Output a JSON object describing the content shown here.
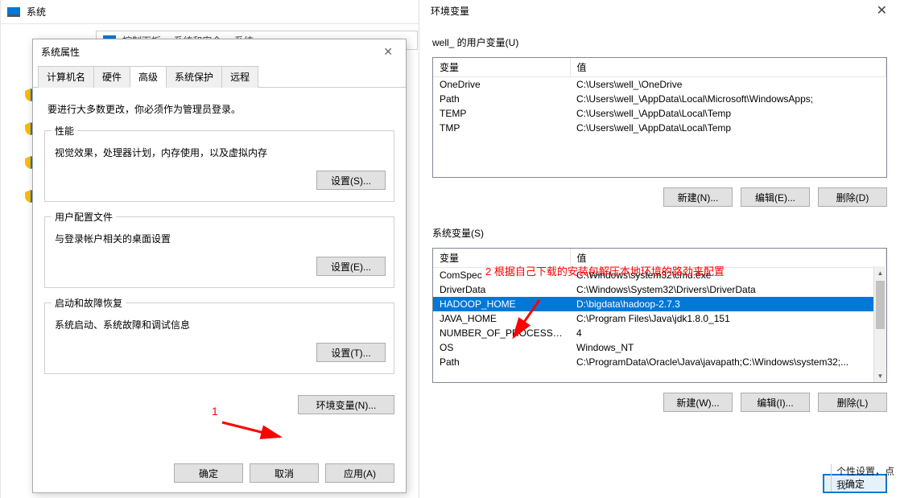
{
  "bg": {
    "title": "系统",
    "breadcrumb": {
      "item1": "控制面板",
      "item2": "系统和安全",
      "item3": "系统"
    }
  },
  "sysprops": {
    "title": "系统属性",
    "tabs": {
      "computer": "计算机名",
      "hardware": "硬件",
      "advanced": "高级",
      "protection": "系统保护",
      "remote": "远程"
    },
    "admin_note": "要进行大多数更改，你必须作为管理员登录。",
    "perf": {
      "title": "性能",
      "desc": "视觉效果，处理器计划，内存使用，以及虚拟内存",
      "btn": "设置(S)..."
    },
    "userprof": {
      "title": "用户配置文件",
      "desc": "与登录帐户相关的桌面设置",
      "btn": "设置(E)..."
    },
    "startup": {
      "title": "启动和故障恢复",
      "desc": "系统启动、系统故障和调试信息",
      "btn": "设置(T)..."
    },
    "env_btn": "环境变量(N)...",
    "buttons": {
      "ok": "确定",
      "cancel": "取消",
      "apply": "应用(A)"
    }
  },
  "annotations": {
    "a1": "1",
    "a2": "2 根据自己下载的安装包解压本地环境的路劲来配置"
  },
  "env": {
    "title": "环境变量",
    "user_label": "well_ 的用户变量(U)",
    "sys_label": "系统变量(S)",
    "headers": {
      "name": "变量",
      "value": "值"
    },
    "user_vars": [
      {
        "name": "OneDrive",
        "value": "C:\\Users\\well_\\OneDrive"
      },
      {
        "name": "Path",
        "value": "C:\\Users\\well_\\AppData\\Local\\Microsoft\\WindowsApps;"
      },
      {
        "name": "TEMP",
        "value": "C:\\Users\\well_\\AppData\\Local\\Temp"
      },
      {
        "name": "TMP",
        "value": "C:\\Users\\well_\\AppData\\Local\\Temp"
      }
    ],
    "sys_vars": [
      {
        "name": "ComSpec",
        "value": "C:\\Windows\\system32\\cmd.exe"
      },
      {
        "name": "DriverData",
        "value": "C:\\Windows\\System32\\Drivers\\DriverData"
      },
      {
        "name": "HADOOP_HOME",
        "value": "D:\\bigdata\\hadoop-2.7.3",
        "selected": true
      },
      {
        "name": "JAVA_HOME",
        "value": "C:\\Program Files\\Java\\jdk1.8.0_151"
      },
      {
        "name": "NUMBER_OF_PROCESSORS",
        "value": "4"
      },
      {
        "name": "OS",
        "value": "Windows_NT"
      },
      {
        "name": "Path",
        "value": "C:\\ProgramData\\Oracle\\Java\\javapath;C:\\Windows\\system32;..."
      }
    ],
    "buttons": {
      "new_n": "新建(N)...",
      "edit_e": "编辑(E)...",
      "del_d": "删除(D)",
      "new_w": "新建(W)...",
      "edit_i": "编辑(I)...",
      "del_l": "删除(L)",
      "ok": "确定"
    }
  },
  "personal": "个性设置，点我"
}
